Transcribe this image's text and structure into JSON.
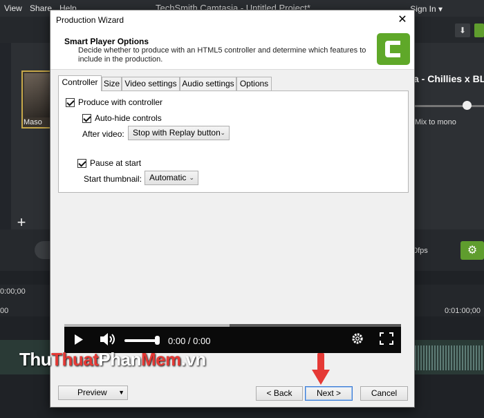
{
  "app": {
    "menu": [
      "View",
      "Share",
      "Help"
    ],
    "title": "TechSmith Camtasia - Untitled Project*",
    "signin": "Sign In ▾",
    "thumb_label": "Maso",
    "right_title": "a - Chillies x BLA",
    "right_mix": "Mix to mono",
    "fps": "0fps",
    "timecodes": {
      "tc1": "0:00;00",
      "tc2": "00",
      "tc3": "0:01:00;00"
    }
  },
  "watermark": {
    "part1": "Thu",
    "part2": "Thuat",
    "part3": "Phan",
    "part4": "Mem",
    "part5": ".vn"
  },
  "dialog": {
    "title": "Production Wizard",
    "close": "✕",
    "header_title": "Smart Player Options",
    "header_desc": "Decide whether to produce with an HTML5 controller and determine which features to include in the production.",
    "tabs": [
      "Controller",
      "Size",
      "Video settings",
      "Audio settings",
      "Options"
    ],
    "active_tab": "Controller",
    "controller": {
      "produce_with_controller": {
        "label": "Produce with controller",
        "checked": true
      },
      "auto_hide": {
        "label": "Auto-hide controls",
        "checked": true
      },
      "after_video_label": "After video:",
      "after_video_value": "Stop with Replay button",
      "pause_at_start": {
        "label": "Pause at start",
        "checked": true
      },
      "start_thumbnail_label": "Start thumbnail:",
      "start_thumbnail_value": "Automatic"
    },
    "player": {
      "time": "0:00 / 0:00",
      "buffered_fraction": 0.49
    },
    "buttons": {
      "preview": "Preview",
      "back": "< Back",
      "next": "Next >",
      "cancel": "Cancel"
    }
  },
  "colors": {
    "camtasia_green": "#5fa829",
    "arrow_red": "#e53935",
    "focus_blue": "#3a7bd5"
  }
}
